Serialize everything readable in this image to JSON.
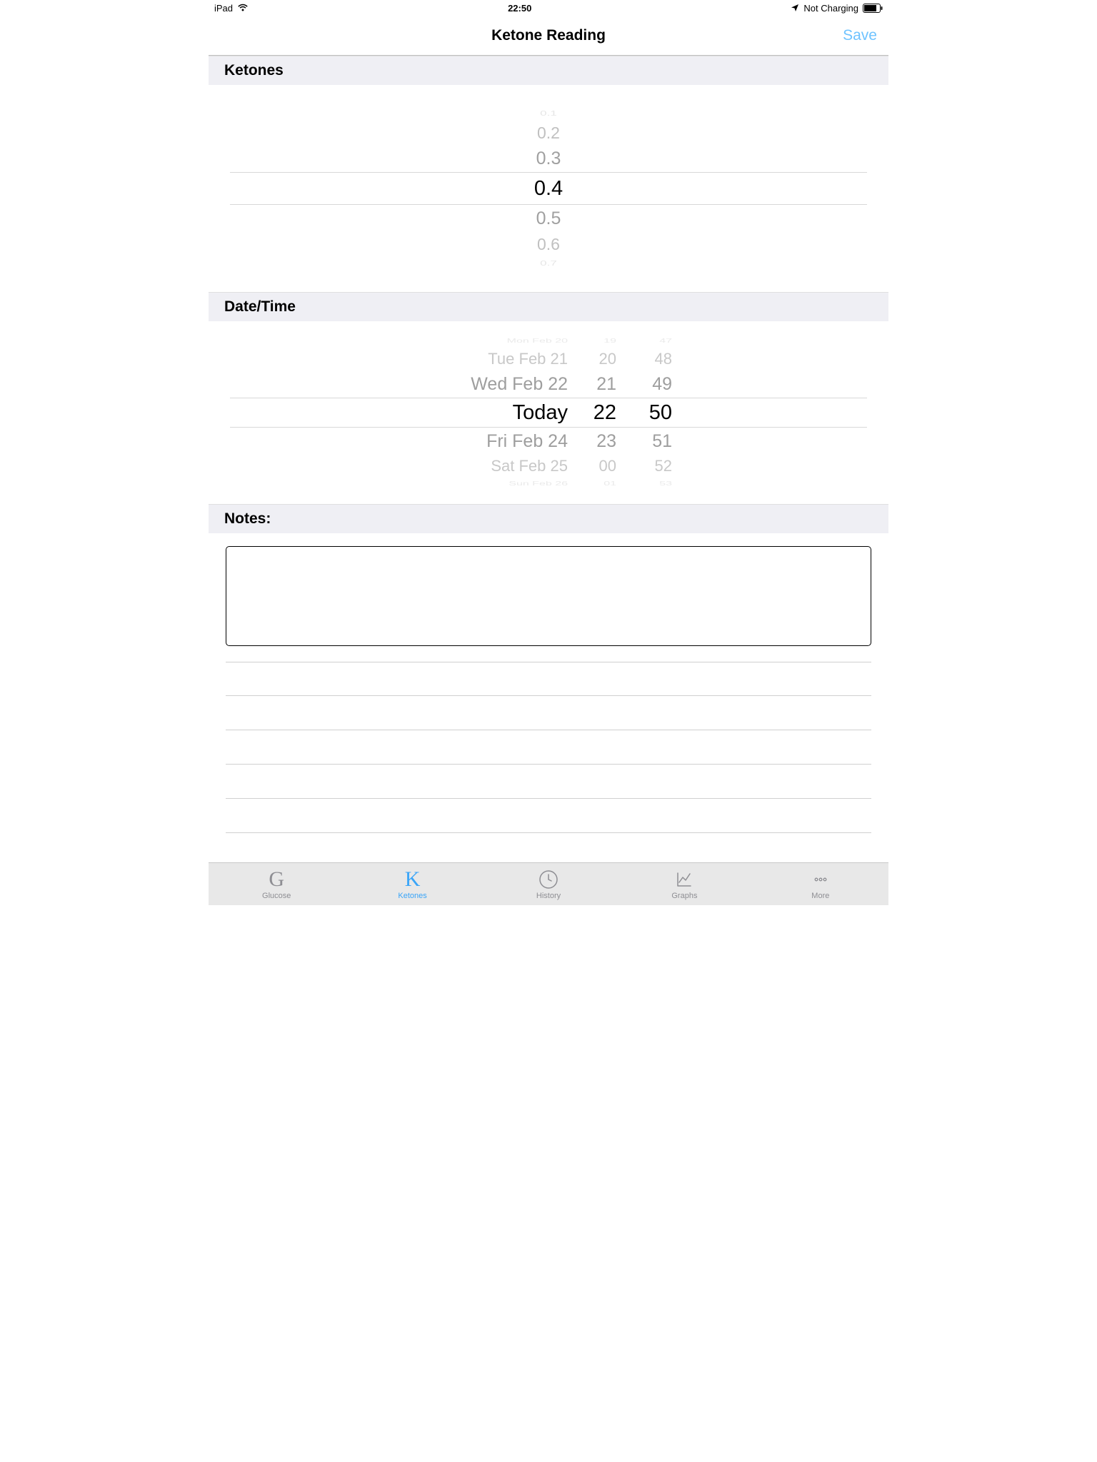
{
  "status": {
    "device": "iPad",
    "time": "22:50",
    "charging": "Not Charging"
  },
  "nav": {
    "title": "Ketone Reading",
    "save": "Save"
  },
  "sections": {
    "ketones": "Ketones",
    "datetime": "Date/Time",
    "notes": "Notes:"
  },
  "ketone_picker": {
    "v0": "0.1",
    "v1": "0.2",
    "v2": "0.3",
    "selected": "0.4",
    "v4": "0.5",
    "v5": "0.6",
    "v6": "0.7"
  },
  "date_picker": {
    "d0": "Mon Feb 20",
    "d1": "Tue Feb 21",
    "d2": "Wed Feb 22",
    "d_sel": "Today",
    "d4": "Fri Feb 24",
    "d5": "Sat Feb 25",
    "d6": "Sun Feb 26",
    "h0": "19",
    "h1": "20",
    "h2": "21",
    "h_sel": "22",
    "h4": "23",
    "h5": "00",
    "h6": "01",
    "m0": "47",
    "m1": "48",
    "m2": "49",
    "m_sel": "50",
    "m4": "51",
    "m5": "52",
    "m6": "53"
  },
  "notes": {
    "value": ""
  },
  "tabs": {
    "glucose": {
      "icon": "G",
      "label": "Glucose"
    },
    "ketones": {
      "icon": "K",
      "label": "Ketones"
    },
    "history": {
      "label": "History"
    },
    "graphs": {
      "label": "Graphs"
    },
    "more": {
      "label": "More"
    }
  }
}
